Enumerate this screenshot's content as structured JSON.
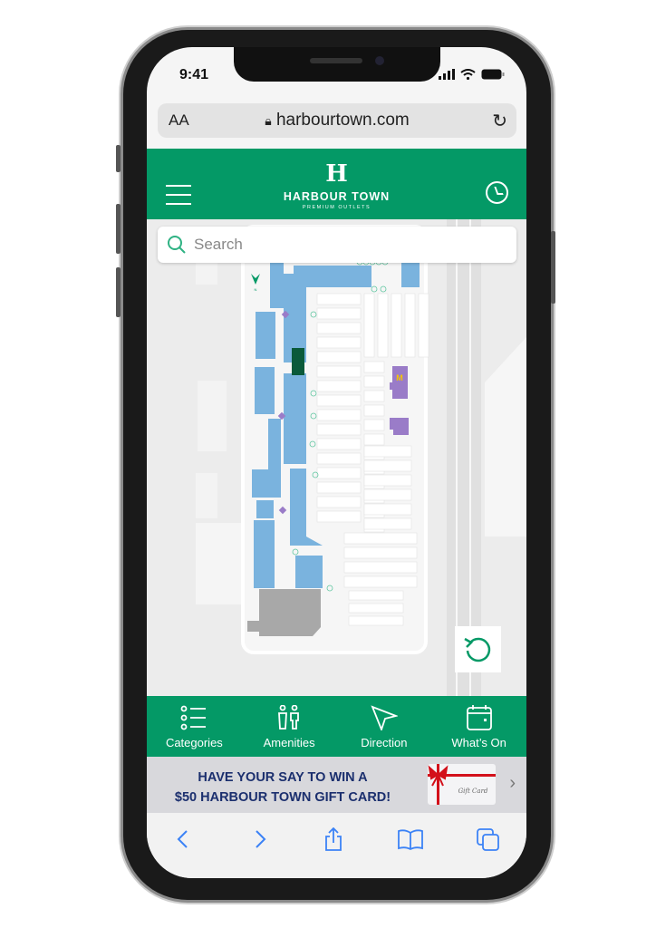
{
  "status_bar": {
    "time": "9:41"
  },
  "browser": {
    "text_size": "AA",
    "url": "harbourtown.com"
  },
  "header": {
    "logo_letter": "H",
    "brand": "HARBOUR TOWN",
    "tagline": "PREMIUM OUTLETS",
    "accent": "#049966"
  },
  "search": {
    "placeholder": "Search"
  },
  "map": {
    "compass": "N",
    "restaurant_logo": "M",
    "colors": {
      "stores": "#7ab3de",
      "anchor": "#a8a8a8",
      "food": "#9a7cc8"
    }
  },
  "tabs": [
    {
      "label": "Categories",
      "icon": "list-icon"
    },
    {
      "label": "Amenities",
      "icon": "restroom-icon"
    },
    {
      "label": "Direction",
      "icon": "navigation-arrow-icon"
    },
    {
      "label": "What’s On",
      "icon": "calendar-icon"
    }
  ],
  "promo": {
    "line1": "HAVE YOUR SAY TO WIN A",
    "line2": "$50 HARBOUR TOWN GIFT CARD!",
    "card_text": "Gift Card"
  },
  "safari_toolbar": [
    "back-icon",
    "forward-icon",
    "share-icon",
    "bookmarks-icon",
    "tabs-icon"
  ]
}
